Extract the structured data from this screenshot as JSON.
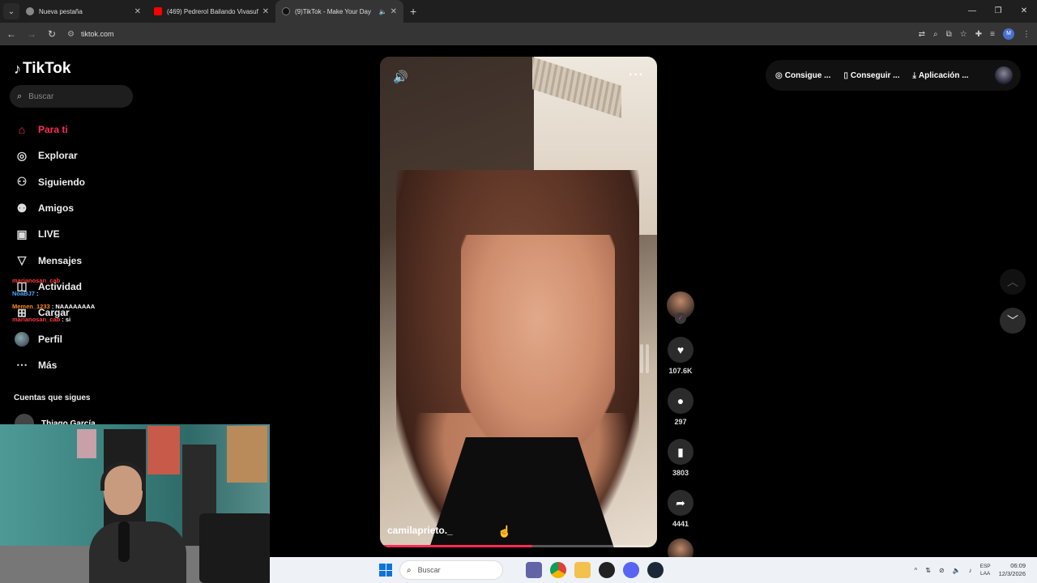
{
  "browser": {
    "tabs": [
      {
        "title": "Nueva pestaña",
        "active": false
      },
      {
        "title": "(469) Pedrerol Bailando Vivasuf",
        "active": false
      },
      {
        "title": "(9)TikTok - Make Your Day",
        "active": true
      }
    ],
    "url": "tiktok.com",
    "profile_initial": "M"
  },
  "tiktok": {
    "logo": "TikTok",
    "search_placeholder": "Buscar",
    "nav": [
      {
        "label": "Para ti",
        "icon": "home-icon"
      },
      {
        "label": "Explorar",
        "icon": "compass-icon"
      },
      {
        "label": "Siguiendo",
        "icon": "following-icon"
      },
      {
        "label": "Amigos",
        "icon": "friends-icon"
      },
      {
        "label": "LIVE",
        "icon": "live-icon"
      },
      {
        "label": "Mensajes",
        "icon": "messages-icon"
      },
      {
        "label": "Actividad",
        "icon": "activity-icon"
      },
      {
        "label": "Cargar",
        "icon": "upload-icon"
      },
      {
        "label": "Perfil",
        "icon": "profile-avatar"
      },
      {
        "label": "Más",
        "icon": "more-icon"
      }
    ],
    "following_title": "Cuentas que sigues",
    "following": [
      {
        "name": "Thiago García"
      }
    ],
    "video": {
      "username": "camilaprieto._",
      "progress_fraction": 0.55
    },
    "actions": {
      "likes": "107.6K",
      "comments": "297",
      "saves": "3803",
      "shares": "4441"
    },
    "topbar": {
      "coins": "Consigue ...",
      "get": "Conseguir ...",
      "app": "Aplicación ..."
    }
  },
  "stream_chat": [
    {
      "user": "marianosan_cab",
      "msg": ""
    },
    {
      "user": "NoaBJ7",
      "msg": ":"
    },
    {
      "user": "Memen_1233",
      "msg": ": NAAAAAAAA"
    },
    {
      "user": "marianosan_cab",
      "msg": ": si"
    }
  ],
  "taskbar": {
    "search_placeholder": "Buscar",
    "lang_line1": "ESP",
    "lang_line2": "LAA",
    "time": "06:09",
    "date": "12/3/2026"
  },
  "colors": {
    "accent": "#fe2c55",
    "background": "#000000"
  }
}
